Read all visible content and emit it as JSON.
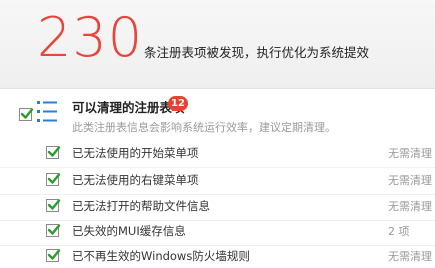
{
  "header": {
    "count": "230",
    "summary": "条注册表项被发现，执行优化为系统提效"
  },
  "category": {
    "title": "可以清理的注册表项",
    "badge": "12",
    "description": "此类注册表信息会影响系统运行效率，建议定期清理。",
    "checked": true
  },
  "items": [
    {
      "label": "已无法使用的开始菜单项",
      "status": "无需清理",
      "checked": true
    },
    {
      "label": "已无法使用的右键菜单项",
      "status": "无需清理",
      "checked": true
    },
    {
      "label": "已无法打开的帮助文件信息",
      "status": "无需清理",
      "checked": true
    },
    {
      "label": "已失效的MUI缓存信息",
      "status": "2 项",
      "checked": true
    },
    {
      "label": "已不再生效的Windows防火墙规则",
      "status": "无需清理",
      "checked": true
    }
  ],
  "colors": {
    "accent_red": "#e8463a",
    "check_green": "#2e9b2e",
    "icon_blue": "#2a7fd4"
  }
}
